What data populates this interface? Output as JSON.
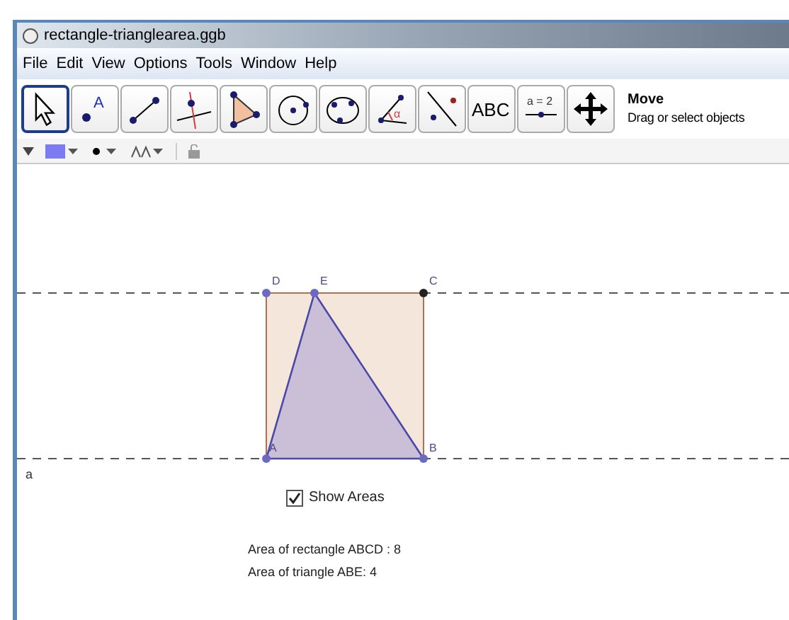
{
  "window": {
    "title": "rectangle-trianglearea.ggb"
  },
  "menu": [
    "File",
    "Edit",
    "View",
    "Options",
    "Tools",
    "Window",
    "Help"
  ],
  "tools": [
    {
      "kind": "move",
      "selected": true
    },
    {
      "kind": "point",
      "label": "A",
      "selected": false
    },
    {
      "kind": "segment",
      "selected": false
    },
    {
      "kind": "perpendicular",
      "selected": false
    },
    {
      "kind": "polygon",
      "selected": false
    },
    {
      "kind": "circle",
      "selected": false
    },
    {
      "kind": "conic",
      "selected": false
    },
    {
      "kind": "angle",
      "label": "α",
      "selected": false
    },
    {
      "kind": "reflect",
      "selected": false
    },
    {
      "kind": "text",
      "label": "ABC",
      "selected": false
    },
    {
      "kind": "slider",
      "label": "a = 2",
      "selected": false
    },
    {
      "kind": "move-view",
      "selected": false
    }
  ],
  "tool_help": {
    "name": "Move",
    "description": "Drag or select objects"
  },
  "canvas": {
    "points": [
      "D",
      "E",
      "C",
      "A",
      "B"
    ],
    "line_label": "a",
    "checkbox": {
      "label": "Show Areas",
      "checked": true
    },
    "texts": [
      "Area of rectangle ABCD : 8",
      "Area of triangle ABE: 4"
    ]
  }
}
